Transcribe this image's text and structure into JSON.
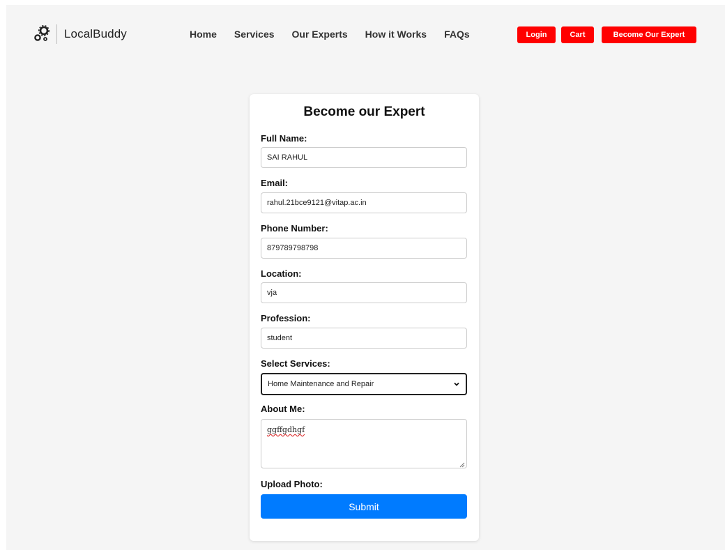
{
  "brand": {
    "name": "LocalBuddy",
    "icon": "gears-icon"
  },
  "nav": {
    "links": [
      "Home",
      "Services",
      "Our Experts",
      "How it Works",
      "FAQs"
    ],
    "login": "Login",
    "cart": "Cart",
    "become_expert": "Become Our Expert"
  },
  "form": {
    "title": "Become our Expert",
    "full_name": {
      "label": "Full Name:",
      "value": "SAI RAHUL"
    },
    "email": {
      "label": "Email:",
      "value": "rahul.21bce9121@vitap.ac.in"
    },
    "phone": {
      "label": "Phone Number:",
      "value": "879789798798"
    },
    "location": {
      "label": "Location:",
      "value": "vja"
    },
    "profession": {
      "label": "Profession:",
      "value": "student"
    },
    "services": {
      "label": "Select Services:",
      "value": "Home Maintenance and Repair"
    },
    "about": {
      "label": "About Me:",
      "value": "ggffgdhgf"
    },
    "photo": {
      "label": "Upload Photo:"
    },
    "submit": "Submit"
  },
  "colors": {
    "accent_red": "#ff0000",
    "submit_blue": "#007bff",
    "background": "#f5f5f5"
  }
}
